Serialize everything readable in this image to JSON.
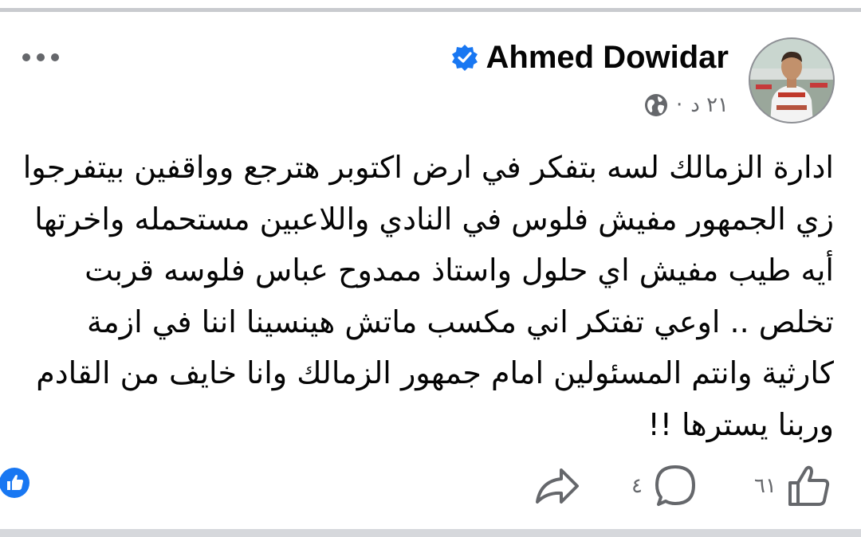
{
  "post": {
    "author": {
      "name": "Ahmed Dowidar",
      "avatar_icon": "profile-photo",
      "verified_icon": "verified-badge-icon",
      "verified_color": "#1877f2"
    },
    "meta": {
      "timestamp": "٢١ د",
      "separator": "·",
      "audience_icon": "globe-icon"
    },
    "more_icon": "more-options-icon",
    "body_lines": [
      "ادارة الزمالك لسه بتفكر في ارض اكتوبر هترجع وواقفين بيتفرجوا",
      "زي الجمهور مفيش فلوس في النادي واللاعبين  مستحمله واخرتها",
      "أيه طيب مفيش اي حلول واستاذ ممدوح عباس فلوسه قربت",
      "تخلص  .. اوعي تفتكر اني مكسب ماتش هينسينا اننا في ازمة",
      "كارثية وانتم المسئولين امام جمهور الزمالك وانا خايف من القادم",
      "وربنا يسترها !!"
    ],
    "reactions": {
      "icon": "like-reaction-icon",
      "color": "#1877f2"
    },
    "actions": {
      "like": {
        "icon": "thumbs-up-icon",
        "count": "٦١"
      },
      "comment": {
        "icon": "comment-icon",
        "count": "٤"
      },
      "share": {
        "icon": "share-icon"
      }
    }
  }
}
